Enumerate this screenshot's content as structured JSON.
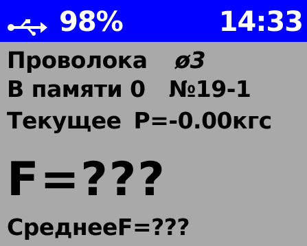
{
  "status": {
    "battery": "98%",
    "time": "14:33",
    "usb_icon": "usb-icon"
  },
  "display": {
    "material_label": "Проволока",
    "diameter": "ø3",
    "memory_label": "В памяти 0",
    "record_id": "№19-1",
    "current_label": "Текущее",
    "current_value": "P=-0.00кгс",
    "force_reading": "F=???",
    "average_reading": "СреднееF=???"
  },
  "colors": {
    "status_bar": "#0000ff",
    "screen_bg": "#a9a9a9",
    "text": "#000000",
    "status_text": "#ffffff"
  }
}
